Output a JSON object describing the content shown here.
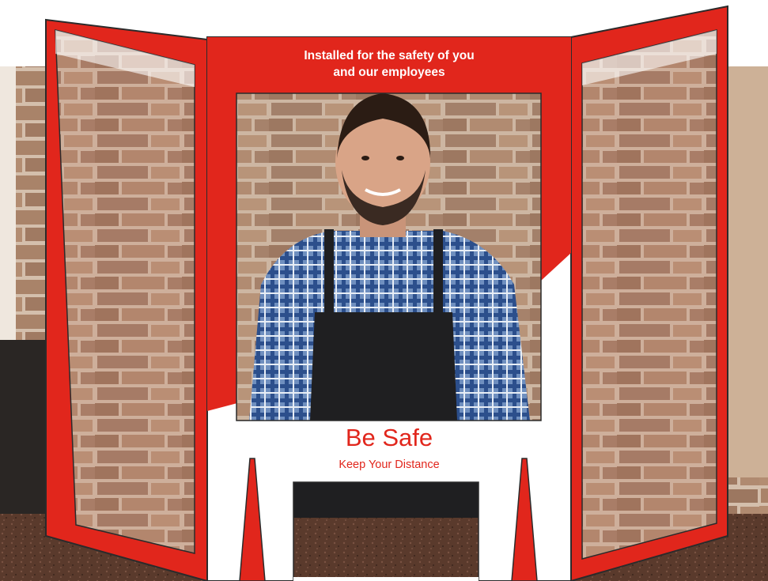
{
  "sign": {
    "headline_line1": "Installed for the safety of you",
    "headline_line2": "and our employees",
    "title": "Be Safe",
    "subtitle": "Keep Your Distance"
  },
  "colors": {
    "brand_red": "#e1261c",
    "panel_outline": "#2b2b2b",
    "brick": "#a8826a",
    "mortar": "#d8c4b2",
    "countertop": "#4a2f24"
  },
  "photo": {
    "subject": "smiling-man-in-plaid-shirt-and-apron",
    "background": "stone-brick-wall"
  }
}
